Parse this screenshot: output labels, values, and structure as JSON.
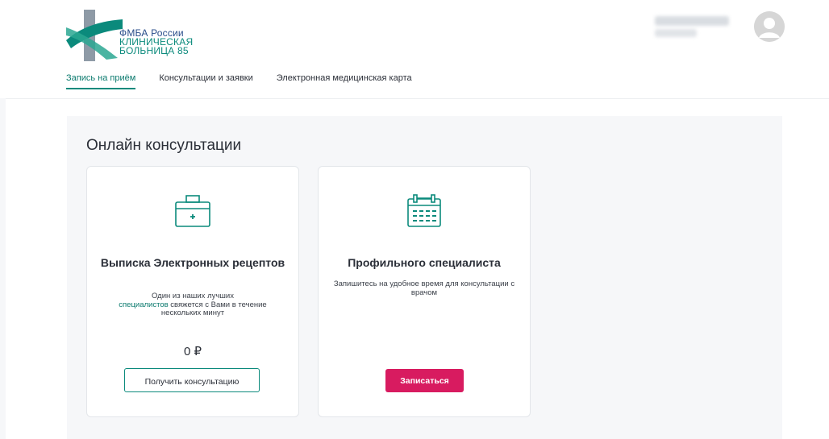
{
  "logo": {
    "line1": "ФМБА России",
    "line2": "КЛИНИЧЕСКАЯ",
    "line3": "БОЛЬНИЦА 85",
    "colors": {
      "teal": "#0b8a7c",
      "navy": "#274b89"
    }
  },
  "nav": {
    "items": [
      {
        "label": "Запись на приём",
        "active": true
      },
      {
        "label": "Консультации и заявки",
        "active": false
      },
      {
        "label": "Электронная медицинская карта",
        "active": false
      }
    ]
  },
  "main": {
    "title": "Онлайн консультации",
    "cards": [
      {
        "icon": "medical-case-icon",
        "title": "Выписка Электронных рецептов",
        "desc_line1": "Один из наших лучших",
        "desc_link": "специалистов",
        "desc_rest": " свяжется с Вами в течение нескольких минут",
        "price": "0 ₽",
        "button": "Получить консультацию"
      },
      {
        "icon": "calendar-icon",
        "title": "Профильного специалиста",
        "desc": "Запишитесь на удобное время для консультации с врачом",
        "button": "Записаться"
      }
    ]
  },
  "colors": {
    "accent": "#0b8a7c",
    "primary_button": "#d81b60",
    "panel_bg": "#f6f7f9"
  }
}
